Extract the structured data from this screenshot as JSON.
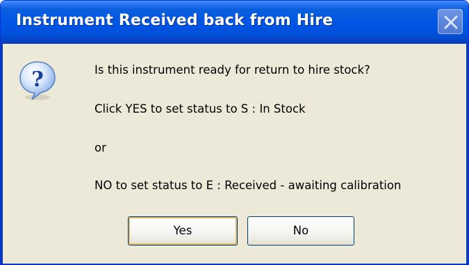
{
  "dialog": {
    "title": "Instrument Received back from Hire",
    "icon": "question-icon",
    "message_lines": [
      "Is this instrument ready for return to hire stock?",
      "Click YES to set status to S : In Stock",
      "or",
      "NO to set status to E : Received - awaiting calibration"
    ],
    "buttons": {
      "yes_label": "Yes",
      "no_label": "No"
    }
  },
  "colors": {
    "titlebar": "#0055e5",
    "dialog_background": "#ece9d8",
    "button_border": "#003c74",
    "default_focus": "#e1b96d"
  }
}
